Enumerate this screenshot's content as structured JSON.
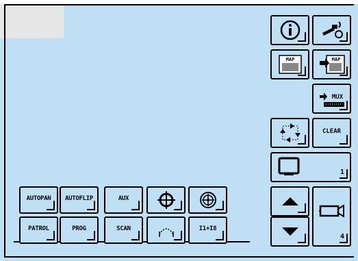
{
  "presets": {
    "autopan": "AUTOPAN",
    "autoflip": "AUTOFLIP",
    "aux": "AUX",
    "patrol": "PATROL",
    "prog": "PROG",
    "scan": "SCAN",
    "iris": "I1+I8"
  },
  "right_panel": {
    "clear": "CLEAR",
    "monitor_number": "1",
    "camera_number": "4",
    "map_label": "MAP",
    "map_goto_label": "MAP",
    "mux_label": "MUX"
  },
  "icons": {
    "info": "info-icon",
    "settings": "camera-settings-icon",
    "map": "map-icon",
    "map_goto": "map-goto-icon",
    "mux": "mux-icon",
    "cycle": "cycle-icon",
    "monitor": "monitor-icon",
    "up": "arrow-up-icon",
    "down": "arrow-down-icon",
    "camera": "camera-icon",
    "target": "crosshair-icon",
    "wheel": "wheel-icon",
    "arc": "arc-icon"
  },
  "colors": {
    "background": "#bfe0f4",
    "lines": "#000000"
  }
}
